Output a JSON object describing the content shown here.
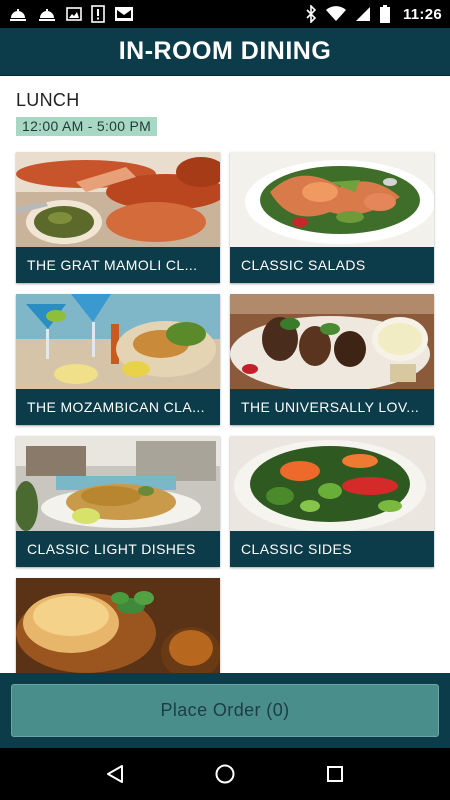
{
  "status_bar": {
    "time": "11:26",
    "left_icons": [
      "room-service-icon",
      "room-service-icon",
      "image-icon",
      "alert-icon",
      "mail-icon"
    ],
    "right_icons": [
      "bluetooth-icon",
      "wifi-icon",
      "signal-icon",
      "battery-icon"
    ]
  },
  "header": {
    "title": "IN-ROOM DINING"
  },
  "menu": {
    "section_title": "LUNCH",
    "hours": "12:00 AM - 5:00 PM",
    "items": [
      {
        "label": "THE GRAT MAMOLI CL..."
      },
      {
        "label": "CLASSIC SALADS"
      },
      {
        "label": "THE MOZAMBICAN CLA..."
      },
      {
        "label": "THE UNIVERSALLY LOV..."
      },
      {
        "label": "CLASSIC LIGHT DISHES"
      },
      {
        "label": "CLASSIC SIDES"
      },
      {
        "label": ""
      }
    ]
  },
  "order": {
    "button_label": "Place Order (0)"
  },
  "nav": {
    "buttons": [
      "back-icon",
      "home-icon",
      "recents-icon"
    ]
  },
  "colors": {
    "primary": "#0c3b4a",
    "accent": "#a8d8c4",
    "button": "#4a8e8c"
  }
}
